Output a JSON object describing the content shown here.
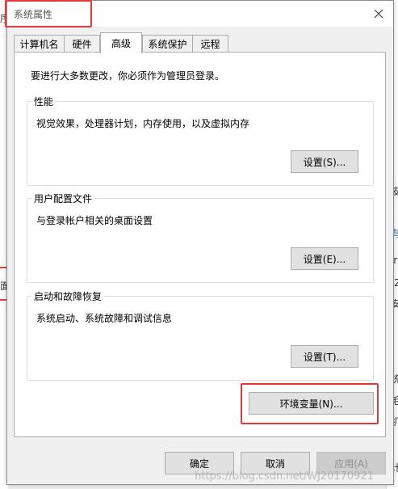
{
  "dialog": {
    "title": "系统属性",
    "close_icon": "close-icon"
  },
  "tabs": [
    {
      "label": "计算机名"
    },
    {
      "label": "硬件"
    },
    {
      "label": "高级",
      "active": true
    },
    {
      "label": "系统保护"
    },
    {
      "label": "远程"
    }
  ],
  "advanced": {
    "intro": "要进行大多数更改，你必须作为管理员登录。",
    "performance": {
      "title": "性能",
      "description": "视觉效果，处理器计划，内存使用，以及虚拟内存",
      "button": "设置(S)..."
    },
    "user_profiles": {
      "title": "用户配置文件",
      "description": "与登录帐户相关的桌面设置",
      "button": "设置(E)..."
    },
    "startup_recovery": {
      "title": "启动和故障恢复",
      "description": "系统启动、系统故障和调试信息",
      "button": "设置(T)..."
    },
    "env_button": "环境变量(N)..."
  },
  "footer": {
    "ok": "确定",
    "cancel": "取消",
    "apply": "应用(A)"
  },
  "watermark": "https://blog.csdn.net/WJ20170921",
  "background_fragments": {
    "left": [
      "序",
      "面"
    ],
    "right": [
      "皮",
      "有",
      "ir",
      "2",
      "安",
      "统",
      "毛",
      "机",
      "计算"
    ]
  },
  "colors": {
    "highlight_red": "#e03a3a"
  }
}
